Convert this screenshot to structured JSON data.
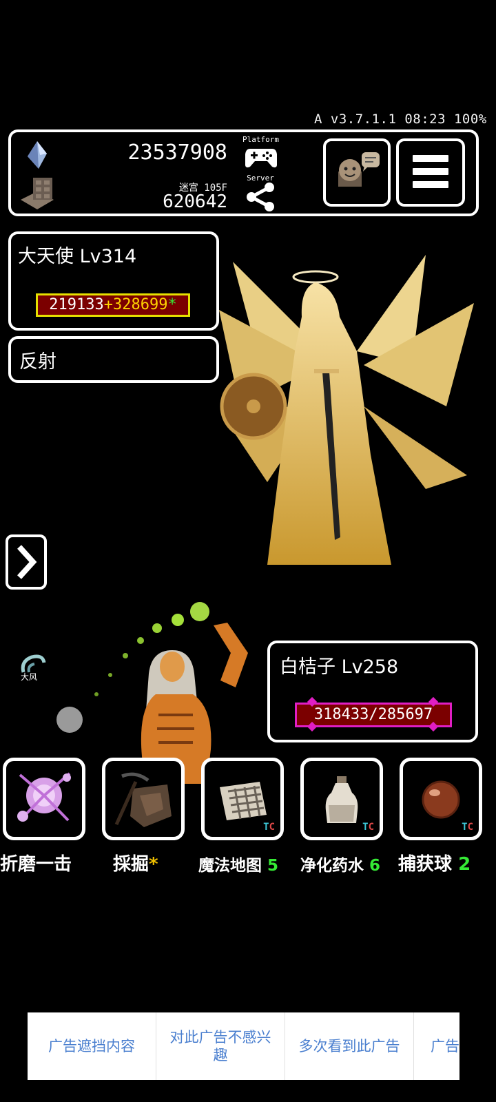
{
  "status_bar": {
    "text": "A v3.7.1.1 08:23 100%"
  },
  "top_panel": {
    "gems": "23537908",
    "maze_label": "迷宫 105F",
    "floor_count": "620642",
    "platform_label": "Platform",
    "server_label": "Server",
    "icons": [
      "crystal-icon",
      "dungeon-floor-icon",
      "gamepad-icon",
      "share-icon",
      "chat-icon",
      "menu-icon"
    ]
  },
  "enemy": {
    "name": "大天使 Lv314",
    "hp_base": "219133",
    "hp_bonus": "+328699",
    "hp_star": "*",
    "skill": "反射",
    "hp_border_color": "#e6e000",
    "hp_fill_color": "#7b0000"
  },
  "player": {
    "name": "白桔子 Lv258",
    "hp": "318433/285697",
    "status_label": "大风",
    "hp_border_color": "#e01ec4"
  },
  "items": [
    {
      "label": "折磨一击",
      "count": "",
      "icon": "magic-orb-icon",
      "tc": false
    },
    {
      "label": "採掘",
      "count": "*",
      "icon": "pickaxe-ore-icon",
      "tc": false
    },
    {
      "label": "魔法地图",
      "count": "5",
      "icon": "magic-map-icon",
      "tc": true
    },
    {
      "label": "净化药水",
      "count": "6",
      "icon": "potion-bottle-icon",
      "tc": true
    },
    {
      "label": "捕获球",
      "count": "2",
      "icon": "capture-ball-icon",
      "tc": true
    }
  ],
  "tc_badge": {
    "t": "T",
    "c": "C"
  },
  "ad_bar": {
    "options": [
      "广告遮挡内容",
      "对此广告不感兴趣",
      "多次看到此广告",
      "广告"
    ]
  }
}
